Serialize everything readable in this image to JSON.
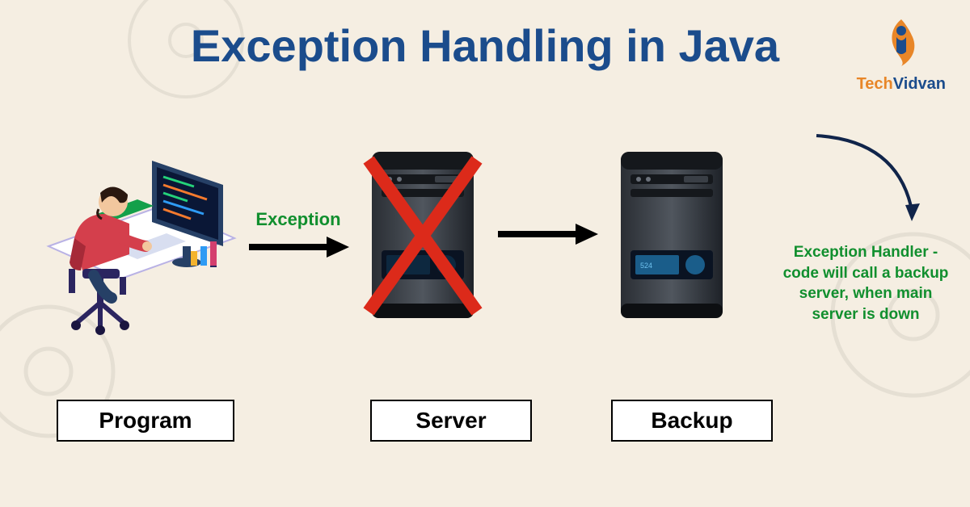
{
  "title": "Exception Handling in Java",
  "brand": {
    "name_a": "Tech",
    "name_b": "Vidvan",
    "color_a": "#e88628",
    "color_b": "#1b4c8c"
  },
  "labels": {
    "program": "Program",
    "server": "Server",
    "backup": "Backup"
  },
  "arrow1_label": "Exception",
  "side_text": "Exception Handler - code will call a backup server, when main server is down",
  "colors": {
    "title": "#1b4c8c",
    "green": "#118f2e"
  }
}
